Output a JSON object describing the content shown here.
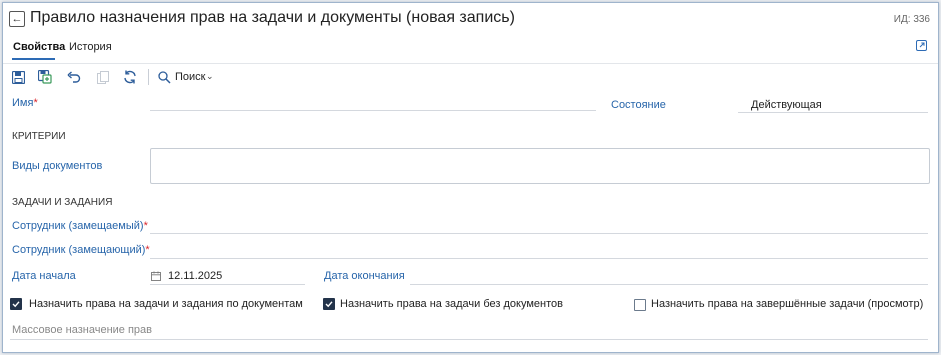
{
  "header": {
    "title": "Правило назначения прав на задачи и документы (новая запись)",
    "id_text": "ИД: 336"
  },
  "tabs": [
    {
      "label": "Свойства",
      "active": true
    },
    {
      "label": "История",
      "active": false
    }
  ],
  "toolbar": {
    "buttons": [
      "save-icon",
      "save-copy-icon",
      "undo-icon",
      "copy-icon",
      "refresh-icon"
    ],
    "search_label": "Поиск"
  },
  "form": {
    "name_label": "Имя",
    "state_label": "Состояние",
    "state_value": "Действующая",
    "criteria_section": "КРИТЕРИИ",
    "doc_types_label": "Виды документов",
    "tasks_section": "ЗАДАЧИ И ЗАДАНИЯ",
    "replaced_employee_label": "Сотрудник (замещаемый)",
    "replacing_employee_label": "Сотрудник (замещающий)",
    "start_date_label": "Дата начала",
    "start_date_value": "12.11.2025",
    "end_date_label": "Дата окончания",
    "checkboxes": [
      {
        "label": "Назначить права на задачи и задания по документам",
        "checked": true
      },
      {
        "label": "Назначить права на задачи без документов",
        "checked": true
      },
      {
        "label": "Назначить права на завершённые задачи (просмотр)",
        "checked": false
      }
    ],
    "mass_assign_label": "Массовое назначение прав"
  },
  "colors": {
    "accent": "#2765aa",
    "required": "#d9262c",
    "check_fill": "#23334a"
  }
}
